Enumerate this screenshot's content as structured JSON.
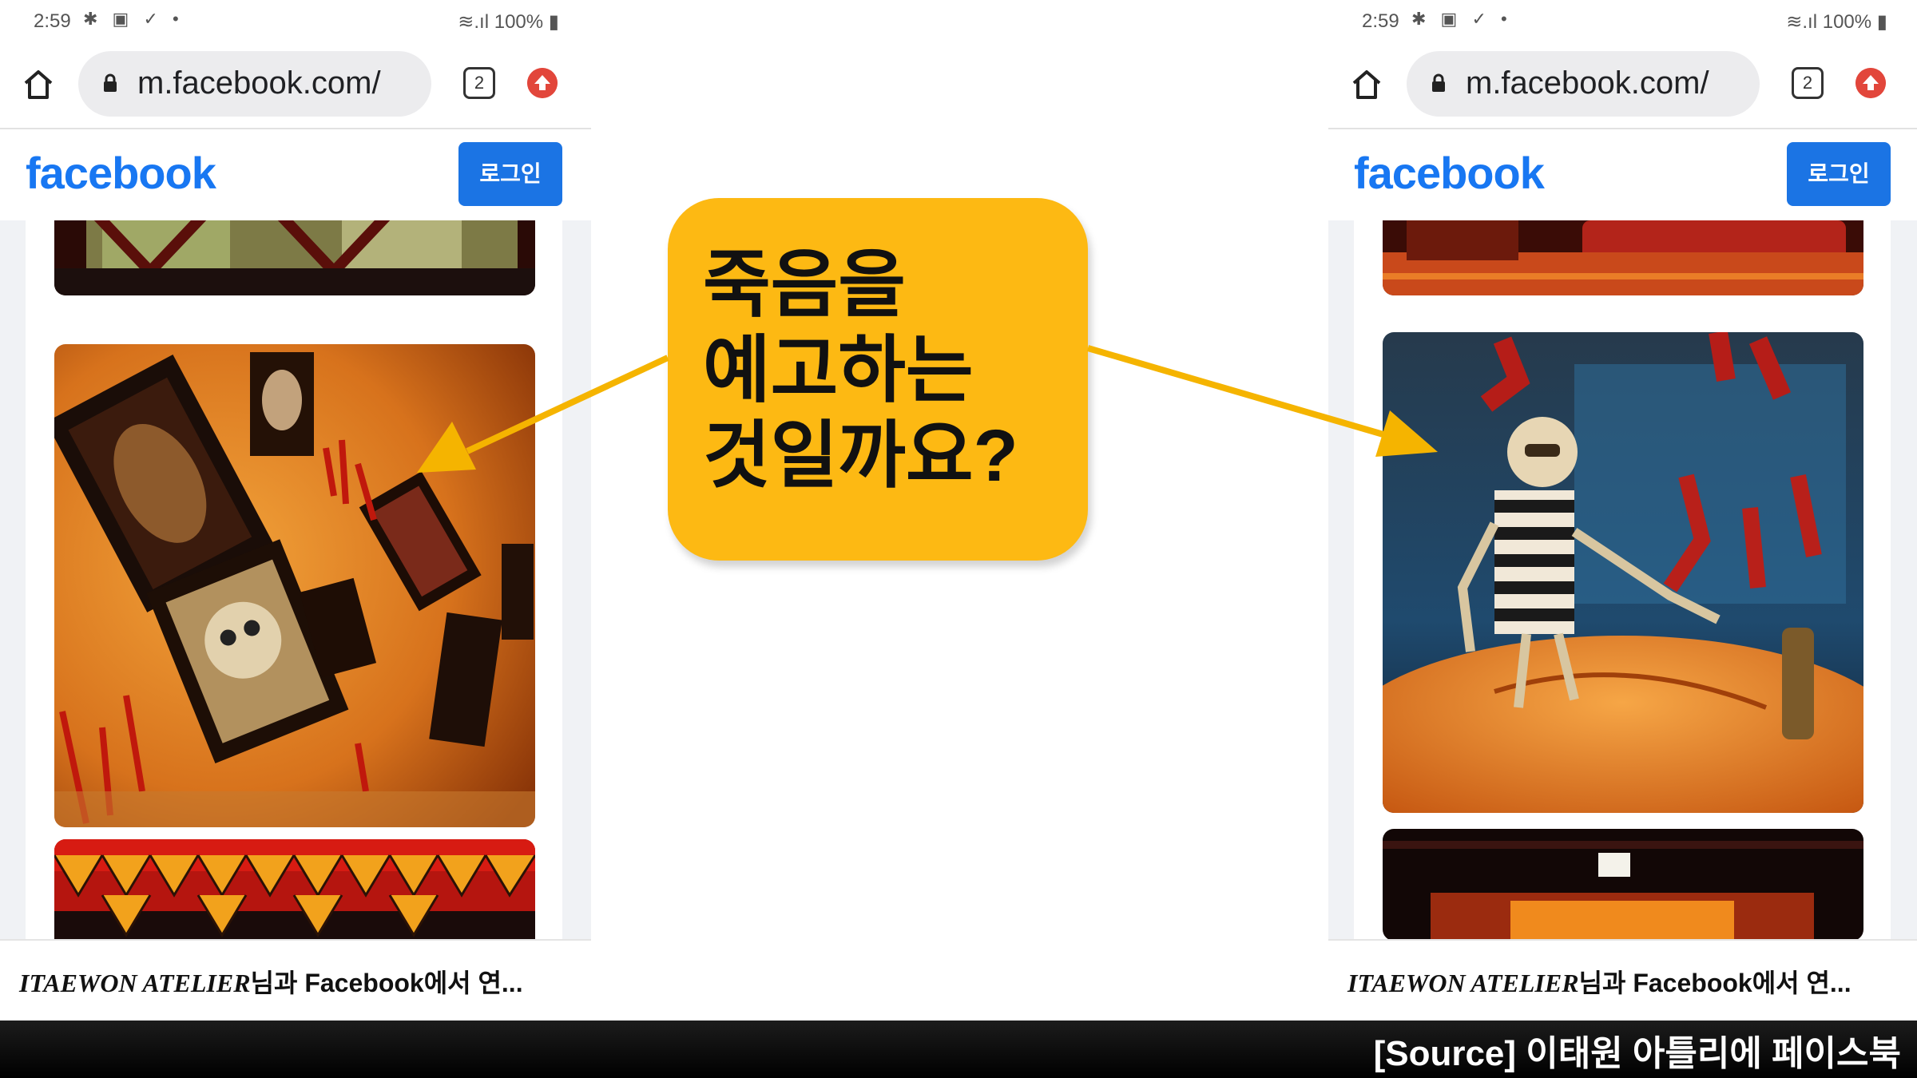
{
  "status_bar": {
    "time": "2:59",
    "icons_left": "✱ ▣ ✓ •",
    "icons_right": "100%"
  },
  "browser": {
    "url": "m.facebook.com/",
    "tab_count": "2",
    "home_icon": "home-icon",
    "lock_icon": "lock-icon",
    "upload_icon": "upload-icon"
  },
  "facebook": {
    "logo": "facebook",
    "login_button": "로그인",
    "caption_page": "ITAEWON ATELIER",
    "caption_rest": "님과 Facebook에서 연..."
  },
  "callout": {
    "text": "죽음을\n예고하는\n것일까요?",
    "color": "#fdb913"
  },
  "source": "[Source] 이태원 아틀리에 페이스북",
  "colors": {
    "facebook_blue": "#1877f2",
    "login_blue": "#1b74e4",
    "arrow": "#f5b400"
  }
}
